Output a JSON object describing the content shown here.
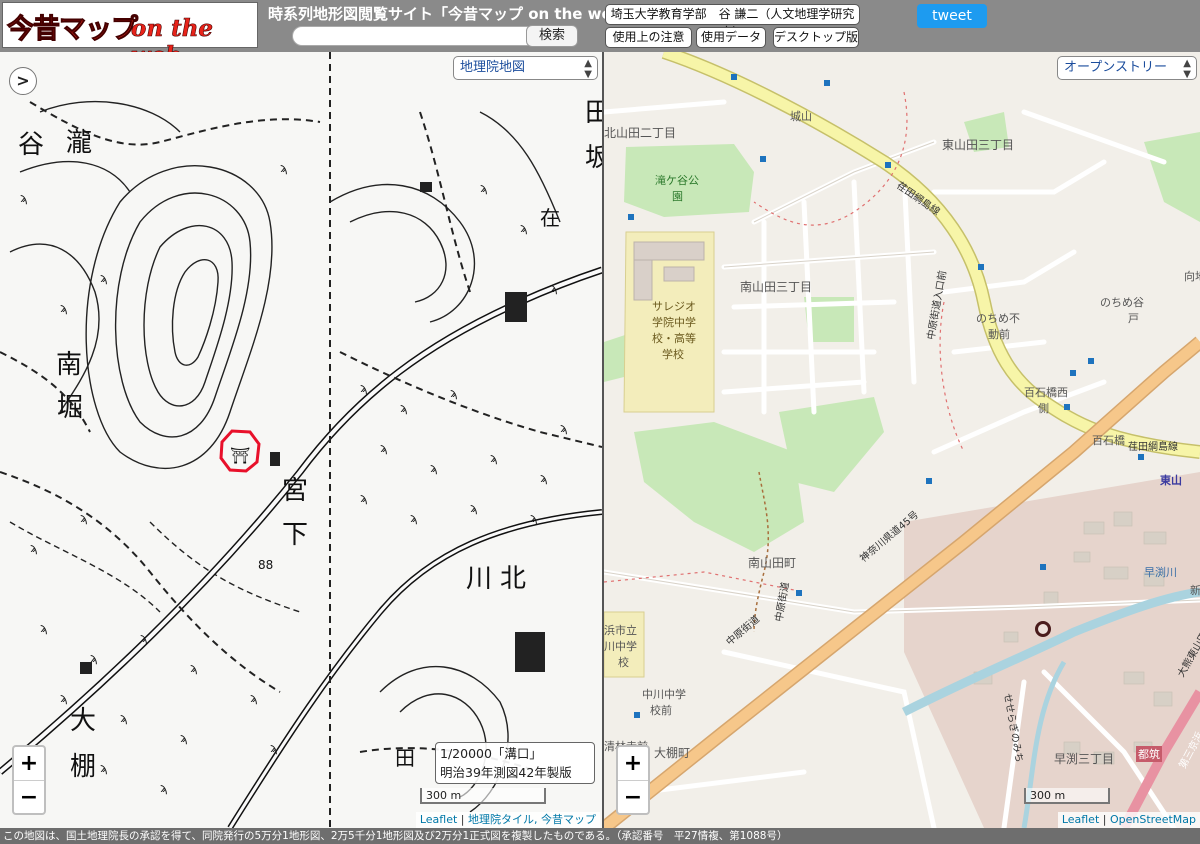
{
  "header": {
    "logo_jp": "今昔マップ",
    "logo_en": "on the web",
    "site_title": "時系列地形図閲覧サイト「今昔マップ on the web」",
    "search_placeholder": "",
    "search_button": "検索",
    "author": "埼玉大学教育学部　谷 謙二（人文地理学研究室）",
    "usage_button": "使用上の注意",
    "data_button": "使用データ",
    "desktop_button": "デスクトップ版",
    "tweet_button": "tweet"
  },
  "left_map": {
    "layer_select": "地理院地図",
    "sidebar_toggle": ">",
    "zoom_in": "+",
    "zoom_out": "−",
    "scale": "300 m",
    "caption_line1": "1/20000「溝口」",
    "caption_line2": "明治39年測図42年製版",
    "attribution": {
      "leaflet": "Leaflet",
      "sep": " | ",
      "source": "地理院タイル, 今昔マップ"
    },
    "place_labels": {
      "l1": "谷",
      "l2": "瀧",
      "l3": "南",
      "l4": "堀",
      "l5": "宮",
      "l6": "下",
      "l7": "川",
      "l8": "北",
      "l9": "大",
      "l10": "棚",
      "l11": "田",
      "l12": "田",
      "l13": "坂",
      "l14": "在",
      "elev": "88"
    }
  },
  "right_map": {
    "layer_select": "オープンストリー",
    "zoom_in": "+",
    "zoom_out": "−",
    "scale": "300 m",
    "attribution": {
      "leaflet": "Leaflet",
      "sep": " | ",
      "source": "OpenStreetMap"
    },
    "labels": {
      "l1": "北山田二丁目",
      "l2": "城山",
      "l3": "東山田三丁目",
      "l4": "滝ケ谷公",
      "l5": "園",
      "l6": "南山田三丁目",
      "l7": "サレジオ",
      "l8": "学院中学",
      "l9": "校・高等",
      "l10": "学校",
      "l11": "のちめ不",
      "l12": "動前",
      "l13": "のちめ谷",
      "l14": "戸",
      "l15": "百石橋西",
      "l16": "側",
      "l17": "百石橋",
      "l18": "東山",
      "l19": "南山田町",
      "l20": "浜市立",
      "l21": "川中学",
      "l22": "校",
      "l23": "中川中学",
      "l24": "校前",
      "l25": "大棚町",
      "l26": "清林寺前",
      "l27": "早渕三丁目",
      "l28": "早渕川",
      "l29": "都筑",
      "l30": "向地",
      "l31": "新"
    },
    "roads": {
      "r1": "荏田綱島線",
      "r2": "中原街道",
      "r3": "神奈川県道45号",
      "r4": "中原街道",
      "r5": "荏田綱島線",
      "r6": "中原街道入口前",
      "r7": "せせらぎのみち",
      "r8": "大熊東山田線",
      "r9": "第三京浜"
    }
  },
  "footer": {
    "text": "この地図は、国土地理院長の承認を得て、同院発行の5万分1地形図、2万5千分1地形図及び2万分1正式図を複製したものである。（承認番号　平27情複、第1088号）"
  }
}
